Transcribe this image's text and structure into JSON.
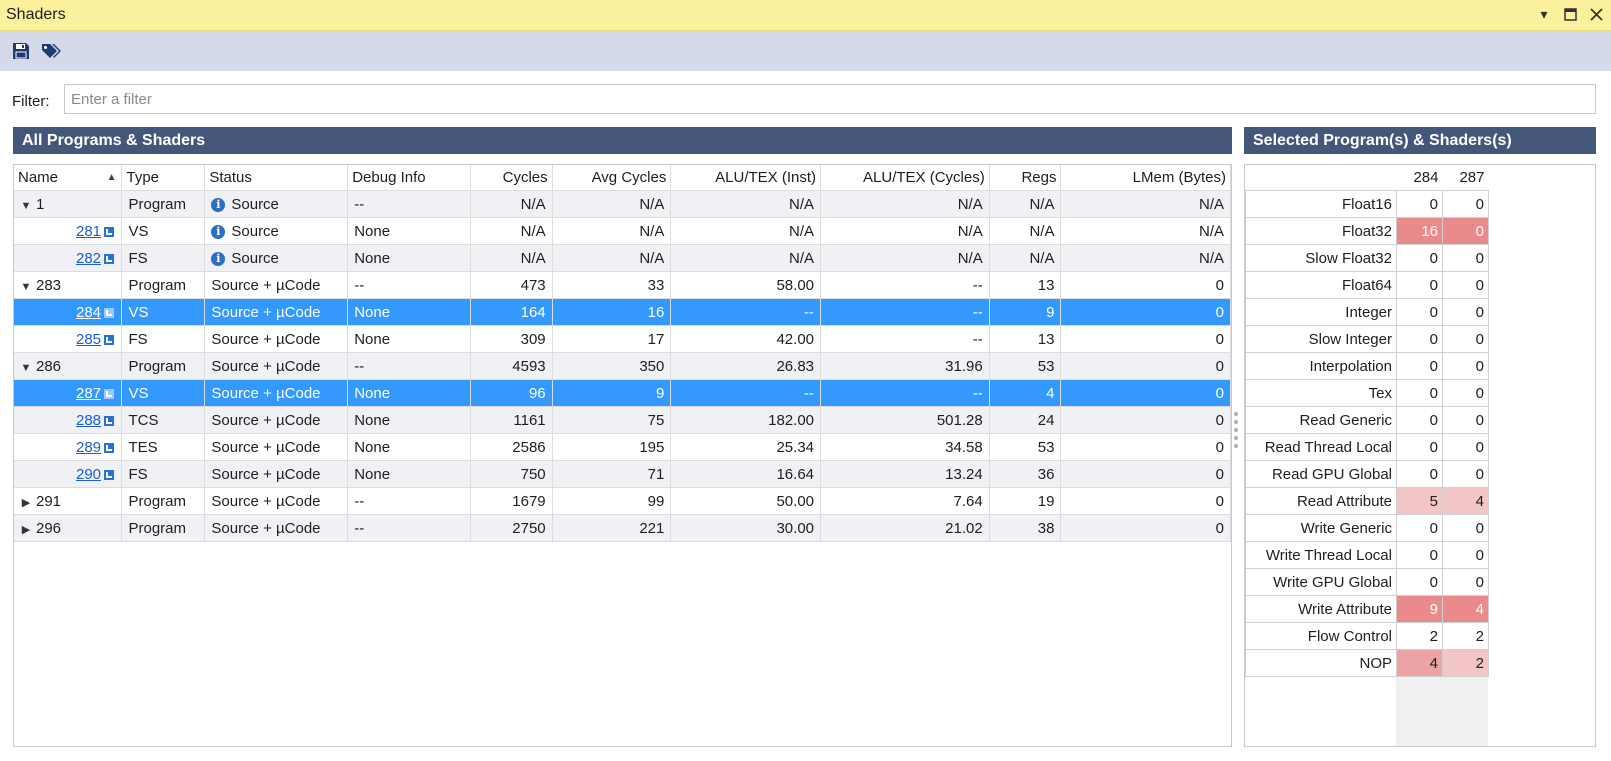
{
  "window": {
    "title": "Shaders"
  },
  "toolbar": {
    "save_icon": "save-icon",
    "tags_icon": "tags-icon"
  },
  "filter": {
    "label": "Filter:",
    "value": "",
    "placeholder": "Enter a filter"
  },
  "left_panel": {
    "title": "All Programs & Shaders",
    "columns": [
      "Name",
      "Type",
      "Status",
      "Debug Info",
      "Cycles",
      "Avg Cycles",
      "ALU/TEX (Inst)",
      "ALU/TEX (Cycles)",
      "Regs",
      "LMem (Bytes)"
    ],
    "sort_indicator": "▲",
    "rows": [
      {
        "name": "1",
        "kind": "parent",
        "expanded": true,
        "type": "Program",
        "status": "Source",
        "info": true,
        "debug": "--",
        "cycles": "N/A",
        "avg": "N/A",
        "alu_inst": "N/A",
        "alu_cyc": "N/A",
        "regs": "N/A",
        "lmem": "N/A",
        "selected": false
      },
      {
        "name": "281",
        "kind": "child",
        "type": "VS",
        "status": "Source",
        "info": true,
        "debug": "None",
        "cycles": "N/A",
        "avg": "N/A",
        "alu_inst": "N/A",
        "alu_cyc": "N/A",
        "regs": "N/A",
        "lmem": "N/A",
        "selected": false
      },
      {
        "name": "282",
        "kind": "child",
        "type": "FS",
        "status": "Source",
        "info": true,
        "debug": "None",
        "cycles": "N/A",
        "avg": "N/A",
        "alu_inst": "N/A",
        "alu_cyc": "N/A",
        "regs": "N/A",
        "lmem": "N/A",
        "selected": false
      },
      {
        "name": "283",
        "kind": "parent",
        "expanded": true,
        "type": "Program",
        "status": "Source + µCode",
        "info": false,
        "debug": "--",
        "cycles": "473",
        "avg": "33",
        "alu_inst": "58.00",
        "alu_cyc": "--",
        "regs": "13",
        "lmem": "0",
        "selected": false
      },
      {
        "name": "284",
        "kind": "child",
        "type": "VS",
        "status": "Source + µCode",
        "info": false,
        "debug": "None",
        "cycles": "164",
        "avg": "16",
        "alu_inst": "--",
        "alu_cyc": "--",
        "regs": "9",
        "lmem": "0",
        "selected": true
      },
      {
        "name": "285",
        "kind": "child",
        "type": "FS",
        "status": "Source + µCode",
        "info": false,
        "debug": "None",
        "cycles": "309",
        "avg": "17",
        "alu_inst": "42.00",
        "alu_cyc": "--",
        "regs": "13",
        "lmem": "0",
        "selected": false
      },
      {
        "name": "286",
        "kind": "parent",
        "expanded": true,
        "type": "Program",
        "status": "Source + µCode",
        "info": false,
        "debug": "--",
        "cycles": "4593",
        "avg": "350",
        "alu_inst": "26.83",
        "alu_cyc": "31.96",
        "regs": "53",
        "lmem": "0",
        "selected": false
      },
      {
        "name": "287",
        "kind": "child",
        "type": "VS",
        "status": "Source + µCode",
        "info": false,
        "debug": "None",
        "cycles": "96",
        "avg": "9",
        "alu_inst": "--",
        "alu_cyc": "--",
        "regs": "4",
        "lmem": "0",
        "selected": true
      },
      {
        "name": "288",
        "kind": "child",
        "type": "TCS",
        "status": "Source + µCode",
        "info": false,
        "debug": "None",
        "cycles": "1161",
        "avg": "75",
        "alu_inst": "182.00",
        "alu_cyc": "501.28",
        "regs": "24",
        "lmem": "0",
        "selected": false
      },
      {
        "name": "289",
        "kind": "child",
        "type": "TES",
        "status": "Source + µCode",
        "info": false,
        "debug": "None",
        "cycles": "2586",
        "avg": "195",
        "alu_inst": "25.34",
        "alu_cyc": "34.58",
        "regs": "53",
        "lmem": "0",
        "selected": false
      },
      {
        "name": "290",
        "kind": "child",
        "type": "FS",
        "status": "Source + µCode",
        "info": false,
        "debug": "None",
        "cycles": "750",
        "avg": "71",
        "alu_inst": "16.64",
        "alu_cyc": "13.24",
        "regs": "36",
        "lmem": "0",
        "selected": false
      },
      {
        "name": "291",
        "kind": "parent",
        "expanded": false,
        "type": "Program",
        "status": "Source + µCode",
        "info": false,
        "debug": "--",
        "cycles": "1679",
        "avg": "99",
        "alu_inst": "50.00",
        "alu_cyc": "7.64",
        "regs": "19",
        "lmem": "0",
        "selected": false
      },
      {
        "name": "296",
        "kind": "parent",
        "expanded": false,
        "type": "Program",
        "status": "Source + µCode",
        "info": false,
        "debug": "--",
        "cycles": "2750",
        "avg": "221",
        "alu_inst": "30.00",
        "alu_cyc": "21.02",
        "regs": "38",
        "lmem": "0",
        "selected": false
      }
    ]
  },
  "right_panel": {
    "title": "Selected Program(s) & Shaders(s)",
    "columns": [
      "284",
      "287"
    ],
    "rows": [
      {
        "label": "Float16",
        "values": [
          "0",
          "0"
        ],
        "heat": [
          "none",
          "none"
        ]
      },
      {
        "label": "Float32",
        "values": [
          "16",
          "0"
        ],
        "heat": [
          "strong",
          "strong"
        ]
      },
      {
        "label": "Slow Float32",
        "values": [
          "0",
          "0"
        ],
        "heat": [
          "none",
          "none"
        ]
      },
      {
        "label": "Float64",
        "values": [
          "0",
          "0"
        ],
        "heat": [
          "none",
          "none"
        ]
      },
      {
        "label": "Integer",
        "values": [
          "0",
          "0"
        ],
        "heat": [
          "none",
          "none"
        ]
      },
      {
        "label": "Slow Integer",
        "values": [
          "0",
          "0"
        ],
        "heat": [
          "none",
          "none"
        ]
      },
      {
        "label": "Interpolation",
        "values": [
          "0",
          "0"
        ],
        "heat": [
          "none",
          "none"
        ]
      },
      {
        "label": "Tex",
        "values": [
          "0",
          "0"
        ],
        "heat": [
          "none",
          "none"
        ]
      },
      {
        "label": "Read Generic",
        "values": [
          "0",
          "0"
        ],
        "heat": [
          "none",
          "none"
        ]
      },
      {
        "label": "Read Thread Local",
        "values": [
          "0",
          "0"
        ],
        "heat": [
          "none",
          "none"
        ]
      },
      {
        "label": "Read GPU Global",
        "values": [
          "0",
          "0"
        ],
        "heat": [
          "none",
          "none"
        ]
      },
      {
        "label": "Read Attribute",
        "values": [
          "5",
          "4"
        ],
        "heat": [
          "light",
          "light"
        ]
      },
      {
        "label": "Write Generic",
        "values": [
          "0",
          "0"
        ],
        "heat": [
          "none",
          "none"
        ]
      },
      {
        "label": "Write Thread Local",
        "values": [
          "0",
          "0"
        ],
        "heat": [
          "none",
          "none"
        ]
      },
      {
        "label": "Write GPU Global",
        "values": [
          "0",
          "0"
        ],
        "heat": [
          "none",
          "none"
        ]
      },
      {
        "label": "Write Attribute",
        "values": [
          "9",
          "4"
        ],
        "heat": [
          "strong",
          "strong"
        ]
      },
      {
        "label": "Flow Control",
        "values": [
          "2",
          "2"
        ],
        "heat": [
          "none",
          "none"
        ]
      },
      {
        "label": "NOP",
        "values": [
          "4",
          "2"
        ],
        "heat": [
          "medium",
          "light"
        ]
      }
    ]
  },
  "colors": {
    "title_bar": "#fbf09d",
    "toolbar": "#d5dae9",
    "panel_header": "#44577a",
    "selection": "#3399ff",
    "heat_none": "#ffffff",
    "heat_light": "#f2c6c6",
    "heat_medium": "#eda3a3",
    "heat_strong": "#ea8a8a",
    "link": "#1a5fd1"
  }
}
